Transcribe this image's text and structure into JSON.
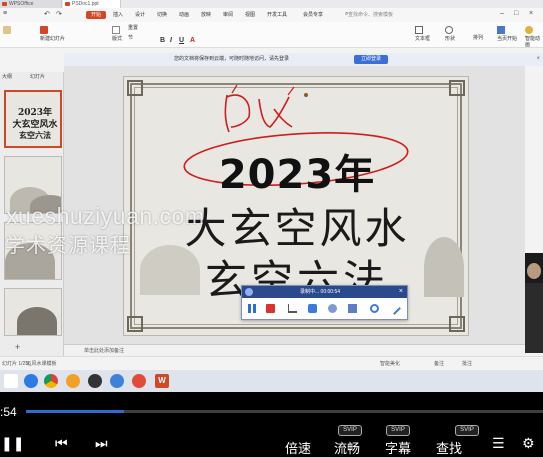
{
  "window_tabs": [
    {
      "label": "WPSOffice"
    },
    {
      "label": "PSDoc1.ppt"
    }
  ],
  "menu": {
    "home": "开始",
    "items": [
      "插入",
      "设计",
      "切换",
      "动画",
      "放映",
      "审阅",
      "视图",
      "开发工具",
      "会员专享"
    ],
    "search_placeholder": "查找命令、搜索模板"
  },
  "toolbar": {
    "new_slide": "新建幻灯片",
    "layout": "版式",
    "reset": "重置",
    "section": "节",
    "text_box": "文本框",
    "shape": "形状",
    "arrange": "排列",
    "slideshow_play": "当页开始",
    "animate": "智能动画"
  },
  "banner": {
    "text": "您的文档将保存到云端，可随时随地访问，请先登录",
    "login_button": "立即登录"
  },
  "left_panel": {
    "tab_outline": "大纲",
    "tab_slides": "幻灯片",
    "thumb1_year": "2023年",
    "thumb1_title": "大玄空风水",
    "thumb1_sub": "玄空六法"
  },
  "slide": {
    "year": "2023年",
    "title": "大玄空风水",
    "subtitle": "玄空六法",
    "handwriting": "风水"
  },
  "notes_placeholder": "单击此处添加备注",
  "statusbar": {
    "slide_info": "幻灯片 1/256",
    "theme": "3_风水课模板",
    "smart_beautify": "智能美化",
    "notes": "备注",
    "comments": "批注"
  },
  "recorder": {
    "status": "录制中... 00:00:54"
  },
  "watermark": {
    "line1": "xueshuziyuan.com",
    "line2": "学术资源课程"
  },
  "player": {
    "time": ":54",
    "progress": 0.19,
    "speed": "倍速",
    "quality": "流畅",
    "subtitle": "字幕",
    "find": "查找",
    "badge": "SVIP"
  },
  "colors": {
    "wps_red": "#d24726",
    "accent_blue": "#2f6bd1",
    "annotation_red": "#d21c1c"
  }
}
